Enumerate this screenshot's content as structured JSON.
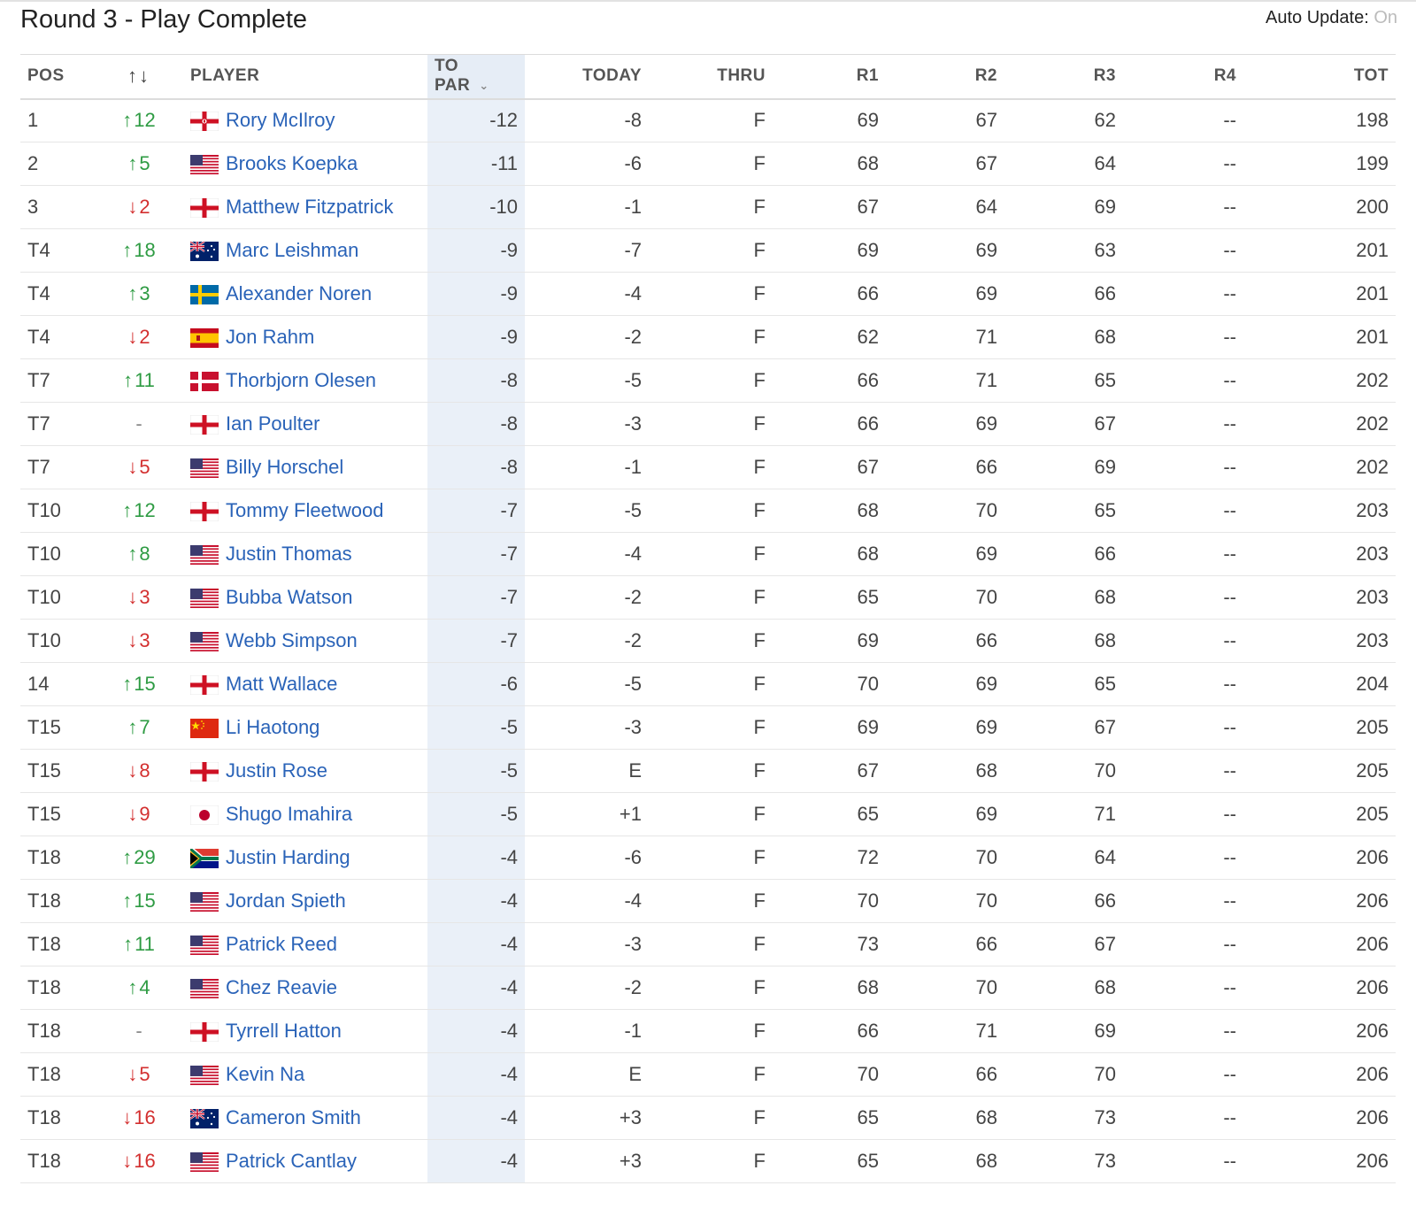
{
  "header": {
    "title": "Round 3 - Play Complete",
    "auto_update_label": "Auto Update:",
    "auto_update_state": "On"
  },
  "columns": {
    "pos": "POS",
    "movement": "↑↓",
    "player": "PLAYER",
    "to_par": "TO PAR",
    "today": "TODAY",
    "thru": "THRU",
    "r1": "R1",
    "r2": "R2",
    "r3": "R3",
    "r4": "R4",
    "tot": "TOT"
  },
  "colors": {
    "link": "#2a63b8",
    "up": "#2e9b43",
    "down": "#d32f2f",
    "to_par_bg": "#eaf0f8"
  },
  "rows": [
    {
      "pos": "1",
      "dir": "up",
      "move": "12",
      "flag": "northern-ireland",
      "player": "Rory McIlroy",
      "to_par": "-12",
      "today": "-8",
      "thru": "F",
      "r1": "69",
      "r2": "67",
      "r3": "62",
      "r4": "--",
      "tot": "198"
    },
    {
      "pos": "2",
      "dir": "up",
      "move": "5",
      "flag": "usa",
      "player": "Brooks Koepka",
      "to_par": "-11",
      "today": "-6",
      "thru": "F",
      "r1": "68",
      "r2": "67",
      "r3": "64",
      "r4": "--",
      "tot": "199"
    },
    {
      "pos": "3",
      "dir": "down",
      "move": "2",
      "flag": "england",
      "player": "Matthew Fitzpatrick",
      "to_par": "-10",
      "today": "-1",
      "thru": "F",
      "r1": "67",
      "r2": "64",
      "r3": "69",
      "r4": "--",
      "tot": "200"
    },
    {
      "pos": "T4",
      "dir": "up",
      "move": "18",
      "flag": "australia",
      "player": "Marc Leishman",
      "to_par": "-9",
      "today": "-7",
      "thru": "F",
      "r1": "69",
      "r2": "69",
      "r3": "63",
      "r4": "--",
      "tot": "201"
    },
    {
      "pos": "T4",
      "dir": "up",
      "move": "3",
      "flag": "sweden",
      "player": "Alexander Noren",
      "to_par": "-9",
      "today": "-4",
      "thru": "F",
      "r1": "66",
      "r2": "69",
      "r3": "66",
      "r4": "--",
      "tot": "201"
    },
    {
      "pos": "T4",
      "dir": "down",
      "move": "2",
      "flag": "spain",
      "player": "Jon Rahm",
      "to_par": "-9",
      "today": "-2",
      "thru": "F",
      "r1": "62",
      "r2": "71",
      "r3": "68",
      "r4": "--",
      "tot": "201"
    },
    {
      "pos": "T7",
      "dir": "up",
      "move": "11",
      "flag": "denmark",
      "player": "Thorbjorn Olesen",
      "to_par": "-8",
      "today": "-5",
      "thru": "F",
      "r1": "66",
      "r2": "71",
      "r3": "65",
      "r4": "--",
      "tot": "202"
    },
    {
      "pos": "T7",
      "dir": "same",
      "move": "-",
      "flag": "england",
      "player": "Ian Poulter",
      "to_par": "-8",
      "today": "-3",
      "thru": "F",
      "r1": "66",
      "r2": "69",
      "r3": "67",
      "r4": "--",
      "tot": "202"
    },
    {
      "pos": "T7",
      "dir": "down",
      "move": "5",
      "flag": "usa",
      "player": "Billy Horschel",
      "to_par": "-8",
      "today": "-1",
      "thru": "F",
      "r1": "67",
      "r2": "66",
      "r3": "69",
      "r4": "--",
      "tot": "202"
    },
    {
      "pos": "T10",
      "dir": "up",
      "move": "12",
      "flag": "england",
      "player": "Tommy Fleetwood",
      "to_par": "-7",
      "today": "-5",
      "thru": "F",
      "r1": "68",
      "r2": "70",
      "r3": "65",
      "r4": "--",
      "tot": "203"
    },
    {
      "pos": "T10",
      "dir": "up",
      "move": "8",
      "flag": "usa",
      "player": "Justin Thomas",
      "to_par": "-7",
      "today": "-4",
      "thru": "F",
      "r1": "68",
      "r2": "69",
      "r3": "66",
      "r4": "--",
      "tot": "203"
    },
    {
      "pos": "T10",
      "dir": "down",
      "move": "3",
      "flag": "usa",
      "player": "Bubba Watson",
      "to_par": "-7",
      "today": "-2",
      "thru": "F",
      "r1": "65",
      "r2": "70",
      "r3": "68",
      "r4": "--",
      "tot": "203"
    },
    {
      "pos": "T10",
      "dir": "down",
      "move": "3",
      "flag": "usa",
      "player": "Webb Simpson",
      "to_par": "-7",
      "today": "-2",
      "thru": "F",
      "r1": "69",
      "r2": "66",
      "r3": "68",
      "r4": "--",
      "tot": "203"
    },
    {
      "pos": "14",
      "dir": "up",
      "move": "15",
      "flag": "england",
      "player": "Matt Wallace",
      "to_par": "-6",
      "today": "-5",
      "thru": "F",
      "r1": "70",
      "r2": "69",
      "r3": "65",
      "r4": "--",
      "tot": "204"
    },
    {
      "pos": "T15",
      "dir": "up",
      "move": "7",
      "flag": "china",
      "player": "Li Haotong",
      "to_par": "-5",
      "today": "-3",
      "thru": "F",
      "r1": "69",
      "r2": "69",
      "r3": "67",
      "r4": "--",
      "tot": "205"
    },
    {
      "pos": "T15",
      "dir": "down",
      "move": "8",
      "flag": "england",
      "player": "Justin Rose",
      "to_par": "-5",
      "today": "E",
      "thru": "F",
      "r1": "67",
      "r2": "68",
      "r3": "70",
      "r4": "--",
      "tot": "205"
    },
    {
      "pos": "T15",
      "dir": "down",
      "move": "9",
      "flag": "japan",
      "player": "Shugo Imahira",
      "to_par": "-5",
      "today": "+1",
      "thru": "F",
      "r1": "65",
      "r2": "69",
      "r3": "71",
      "r4": "--",
      "tot": "205"
    },
    {
      "pos": "T18",
      "dir": "up",
      "move": "29",
      "flag": "south-africa",
      "player": "Justin Harding",
      "to_par": "-4",
      "today": "-6",
      "thru": "F",
      "r1": "72",
      "r2": "70",
      "r3": "64",
      "r4": "--",
      "tot": "206"
    },
    {
      "pos": "T18",
      "dir": "up",
      "move": "15",
      "flag": "usa",
      "player": "Jordan Spieth",
      "to_par": "-4",
      "today": "-4",
      "thru": "F",
      "r1": "70",
      "r2": "70",
      "r3": "66",
      "r4": "--",
      "tot": "206"
    },
    {
      "pos": "T18",
      "dir": "up",
      "move": "11",
      "flag": "usa",
      "player": "Patrick Reed",
      "to_par": "-4",
      "today": "-3",
      "thru": "F",
      "r1": "73",
      "r2": "66",
      "r3": "67",
      "r4": "--",
      "tot": "206"
    },
    {
      "pos": "T18",
      "dir": "up",
      "move": "4",
      "flag": "usa",
      "player": "Chez Reavie",
      "to_par": "-4",
      "today": "-2",
      "thru": "F",
      "r1": "68",
      "r2": "70",
      "r3": "68",
      "r4": "--",
      "tot": "206"
    },
    {
      "pos": "T18",
      "dir": "same",
      "move": "-",
      "flag": "england",
      "player": "Tyrrell Hatton",
      "to_par": "-4",
      "today": "-1",
      "thru": "F",
      "r1": "66",
      "r2": "71",
      "r3": "69",
      "r4": "--",
      "tot": "206"
    },
    {
      "pos": "T18",
      "dir": "down",
      "move": "5",
      "flag": "usa",
      "player": "Kevin Na",
      "to_par": "-4",
      "today": "E",
      "thru": "F",
      "r1": "70",
      "r2": "66",
      "r3": "70",
      "r4": "--",
      "tot": "206"
    },
    {
      "pos": "T18",
      "dir": "down",
      "move": "16",
      "flag": "australia",
      "player": "Cameron Smith",
      "to_par": "-4",
      "today": "+3",
      "thru": "F",
      "r1": "65",
      "r2": "68",
      "r3": "73",
      "r4": "--",
      "tot": "206"
    },
    {
      "pos": "T18",
      "dir": "down",
      "move": "16",
      "flag": "usa",
      "player": "Patrick Cantlay",
      "to_par": "-4",
      "today": "+3",
      "thru": "F",
      "r1": "65",
      "r2": "68",
      "r3": "73",
      "r4": "--",
      "tot": "206"
    }
  ]
}
